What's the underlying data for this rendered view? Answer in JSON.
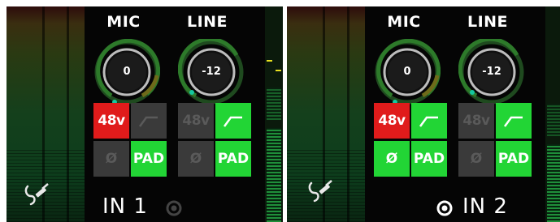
{
  "channels": [
    {
      "mic_label": "MIC",
      "line_label": "LINE",
      "mic_gain": "0",
      "line_gain": "-12",
      "phantom_label": "48v",
      "polarity_label": "Ø",
      "pad_label": "PAD",
      "input_label": "IN 1",
      "phantom_on": true,
      "mic_hpf_on": false,
      "mic_polarity_on": false,
      "mic_pad_on": true,
      "line_phantom_on": false,
      "line_hpf_on": true,
      "line_polarity_on": false,
      "line_pad_on": true,
      "selected": false
    },
    {
      "mic_label": "MIC",
      "line_label": "LINE",
      "mic_gain": "0",
      "line_gain": "-12",
      "phantom_label": "48v",
      "polarity_label": "Ø",
      "pad_label": "PAD",
      "input_label": "IN 2",
      "phantom_on": true,
      "mic_hpf_on": true,
      "mic_polarity_on": true,
      "mic_pad_on": true,
      "line_phantom_on": false,
      "line_hpf_on": true,
      "line_polarity_on": false,
      "line_pad_on": true,
      "selected": true
    }
  ],
  "icons": {
    "jack": "instrument-jack-icon",
    "hpf": "high-pass-filter-icon",
    "select": "input-select-icon"
  },
  "colors": {
    "on_red": "#e01b1b",
    "on_green": "#22d535",
    "off": "#3a3a3a",
    "knob_ring": "#1f6b1f",
    "knob_indicator": "#14c8a0"
  }
}
